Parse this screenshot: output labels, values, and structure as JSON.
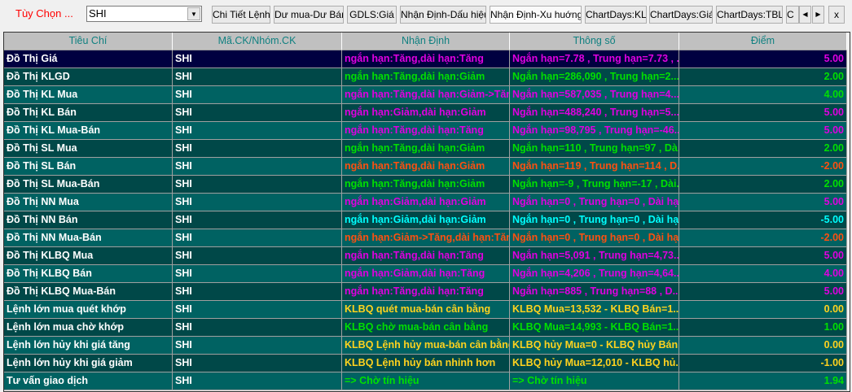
{
  "toolbar": {
    "options_label": "Tùy Chọn ...",
    "symbol": "SHI",
    "buttons": [
      "Chi Tiết Lệnh",
      "Dư mua-Dư Bán",
      "GDLS:Giá",
      "Nhận Định-Dấu hiệu",
      "Nhận Định-Xu huớng",
      "ChartDays:KL",
      "ChartDays:Giá",
      "ChartDays:TBL",
      "C"
    ],
    "active_button": 4,
    "scroll_left": "◀",
    "scroll_right": "▶",
    "close": "x"
  },
  "colors": {
    "magenta": "#e000e0",
    "green": "#00e000",
    "orange": "#ff5010",
    "cyan": "#00ffff",
    "yellow": "#ffd21e",
    "row_dark": "#004848",
    "row_light": "#006262",
    "row_selected": "#000040"
  },
  "table": {
    "headers": [
      "Tiêu Chí",
      "Mã.CK/Nhóm.CK",
      "Nhận Định",
      "Thông số",
      "Điểm"
    ],
    "rows": [
      {
        "criterion": "Đồ Thị Giá",
        "symbol": "SHI",
        "assessment": "ngắn hạn:Tăng,dài hạn:Tăng",
        "params": "Ngắn hạn=7.78 , Trung hạn=7.73 , ...",
        "score": "5.00",
        "color": "magenta"
      },
      {
        "criterion": "Đồ Thị KLGD",
        "symbol": "SHI",
        "assessment": "ngắn hạn:Tăng,dài hạn:Giảm",
        "params": "Ngắn hạn=286,090 , Trung hạn=2...",
        "score": "2.00",
        "color": "green"
      },
      {
        "criterion": "Đồ Thị KL Mua",
        "symbol": "SHI",
        "assessment": "ngắn hạn:Tăng,dài hạn:Giảm->Tăng",
        "params": "Ngắn hạn=587,035 , Trung hạn=4...",
        "score": "4.00",
        "color": "magenta",
        "score_color": "green"
      },
      {
        "criterion": "Đồ Thị KL Bán",
        "symbol": "SHI",
        "assessment": "ngắn hạn:Giảm,dài hạn:Giảm",
        "params": "Ngắn hạn=488,240 , Trung hạn=5...",
        "score": "5.00",
        "color": "magenta"
      },
      {
        "criterion": "Đồ Thị KL Mua-Bán",
        "symbol": "SHI",
        "assessment": "ngắn hạn:Tăng,dài hạn:Tăng",
        "params": "Ngắn hạn=98,795 , Trung hạn=-46...",
        "score": "5.00",
        "color": "magenta"
      },
      {
        "criterion": "Đồ Thị SL Mua",
        "symbol": "SHI",
        "assessment": "ngắn hạn:Tăng,dài hạn:Giảm",
        "params": "Ngắn hạn=110 , Trung hạn=97 , Dà...",
        "score": "2.00",
        "color": "green"
      },
      {
        "criterion": "Đồ Thị SL Bán",
        "symbol": "SHI",
        "assessment": "ngắn hạn:Tăng,dài hạn:Giảm",
        "params": "Ngắn hạn=119 , Trung hạn=114 , D...",
        "score": "-2.00",
        "color": "orange"
      },
      {
        "criterion": "Đồ Thị SL Mua-Bán",
        "symbol": "SHI",
        "assessment": "ngắn hạn:Tăng,dài hạn:Giảm",
        "params": "Ngắn hạn=-9 , Trung hạn=-17 , Dài...",
        "score": "2.00",
        "color": "green"
      },
      {
        "criterion": "Đồ Thị NN Mua",
        "symbol": "SHI",
        "assessment": "ngắn hạn:Giảm,dài hạn:Giảm",
        "params": "Ngắn hạn=0 , Trung hạn=0 , Dài hạ...",
        "score": "5.00",
        "color": "magenta"
      },
      {
        "criterion": "Đồ Thị NN Bán",
        "symbol": "SHI",
        "assessment": "ngắn hạn:Giảm,dài hạn:Giảm",
        "params": "Ngắn hạn=0 , Trung hạn=0 , Dài hạ...",
        "score": "-5.00",
        "color": "cyan"
      },
      {
        "criterion": "Đồ Thị NN Mua-Bán",
        "symbol": "SHI",
        "assessment": "ngắn hạn:Giảm->Tăng,dài hạn:Tăng",
        "params": "Ngắn hạn=0 , Trung hạn=0 , Dài hạ...",
        "score": "-2.00",
        "color": "orange"
      },
      {
        "criterion": "Đồ Thị KLBQ Mua",
        "symbol": "SHI",
        "assessment": "ngắn hạn:Tăng,dài hạn:Tăng",
        "params": "Ngắn hạn=5,091 , Trung hạn=4,73...",
        "score": "5.00",
        "color": "magenta"
      },
      {
        "criterion": "Đồ Thị KLBQ Bán",
        "symbol": "SHI",
        "assessment": "ngắn hạn:Giảm,dài hạn:Tăng",
        "params": "Ngắn hạn=4,206 , Trung hạn=4,64...",
        "score": "4.00",
        "color": "magenta"
      },
      {
        "criterion": "Đồ Thị KLBQ Mua-Bán",
        "symbol": "SHI",
        "assessment": "ngắn hạn:Tăng,dài hạn:Tăng",
        "params": "Ngắn hạn=885 , Trung hạn=88 , D...",
        "score": "5.00",
        "color": "magenta"
      },
      {
        "criterion": "Lệnh lớn mua quét khớp",
        "symbol": "SHI",
        "assessment": "KLBQ quét mua-bán cân bằng",
        "params": "KLBQ Mua=13,532 - KLBQ Bán=1...",
        "score": "0.00",
        "color": "yellow"
      },
      {
        "criterion": "Lệnh lớn mua chờ khớp",
        "symbol": "SHI",
        "assessment": "KLBQ chờ mua-bán cân bằng",
        "params": "KLBQ Mua=14,993 - KLBQ Bán=1...",
        "score": "1.00",
        "color": "green"
      },
      {
        "criterion": "Lệnh lớn hủy khi giá tăng",
        "symbol": "SHI",
        "assessment": "KLBQ Lệnh hủy mua-bán cân bằng",
        "params": "KLBQ hủy Mua=0 - KLBQ hủy Bán...",
        "score": "0.00",
        "color": "yellow"
      },
      {
        "criterion": "Lệnh lớn hủy khi giá giảm",
        "symbol": "SHI",
        "assessment": "KLBQ Lệnh hủy bán nhỉnh hơn",
        "params": "KLBQ hủy Mua=12,010 - KLBQ hủ...",
        "score": "-1.00",
        "color": "yellow"
      },
      {
        "criterion": "Tư vấn giao dịch",
        "symbol": "SHI",
        "assessment": "=> Chờ tín hiệu",
        "params": "=> Chờ tín hiệu",
        "score": "1.94",
        "color": "green"
      }
    ]
  }
}
